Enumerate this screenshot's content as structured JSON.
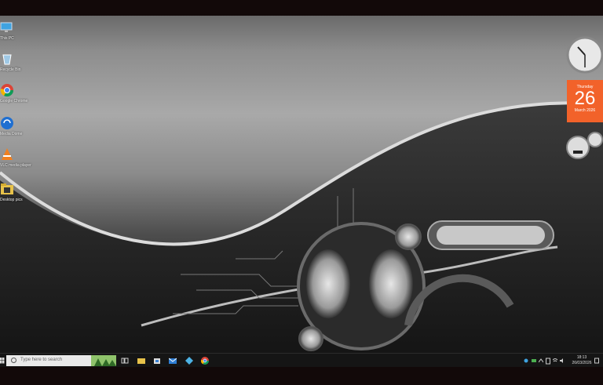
{
  "desktop": {
    "icons": [
      {
        "label": "This PC",
        "icon": "monitor-icon"
      },
      {
        "label": "Recycle Bin",
        "icon": "recycle-bin-icon"
      },
      {
        "label": "Google Chrome",
        "icon": "chrome-icon"
      },
      {
        "label": "Media Dome",
        "icon": "media-dome-icon"
      },
      {
        "label": "VLC media player",
        "icon": "vlc-icon"
      },
      {
        "label": "Desktop pics",
        "icon": "folder-icon"
      }
    ]
  },
  "gadgets": {
    "calendar": {
      "weekday": "Thursday",
      "day": "26",
      "month_year": "March 2026"
    }
  },
  "taskbar": {
    "search_placeholder": "Type here to search",
    "clock": {
      "time": "18:13",
      "date": "26/03/2026"
    }
  },
  "colors": {
    "calendar_accent": "#f2622a",
    "taskbar": "#151515",
    "search_box": "#e9e9e9"
  }
}
